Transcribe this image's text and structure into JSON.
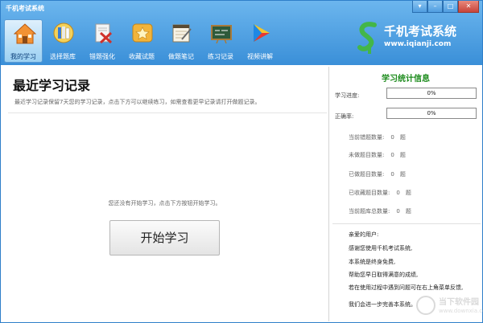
{
  "window": {
    "title": "千机考试系统",
    "minimize_glyph": "▾",
    "min_glyph": "–",
    "max_glyph": "□",
    "close_glyph": "✕"
  },
  "toolbar": {
    "items": [
      {
        "label": "我的学习",
        "icon": "home-icon",
        "active": true
      },
      {
        "label": "选择题库",
        "icon": "book-stack-icon",
        "active": false
      },
      {
        "label": "错题强化",
        "icon": "error-book-icon",
        "active": false
      },
      {
        "label": "收藏试题",
        "icon": "star-folder-icon",
        "active": false
      },
      {
        "label": "做题笔记",
        "icon": "notebook-icon",
        "active": false
      },
      {
        "label": "练习记录",
        "icon": "blackboard-icon",
        "active": false
      },
      {
        "label": "视频讲解",
        "icon": "play-icon",
        "active": false
      }
    ]
  },
  "logo": {
    "name": "千机考试系统",
    "url": "www.iqianji.com"
  },
  "main": {
    "title": "最近学习记录",
    "subtitle": "最近学习记录保留7天您的学习记录，点击下方可以继续练习，如需查看更早记录请打开做题记录。",
    "empty_hint": "您还没有开始学习，点击下方按钮开始学习。",
    "start_button": "开始学习"
  },
  "stats": {
    "title": "学习统计信息",
    "progress_label": "学习进度:",
    "progress_value": "0%",
    "progress_fraction": 0,
    "accuracy_label": "正确率:",
    "accuracy_value": "0%",
    "accuracy_fraction": 0,
    "items": [
      {
        "label": "当前错题数量:",
        "value": "0",
        "unit": "题"
      },
      {
        "label": "未做题目数量:",
        "value": "0",
        "unit": "题"
      },
      {
        "label": "已做题目数量:",
        "value": "0",
        "unit": "题"
      },
      {
        "label": "已收藏题目数量:",
        "value": "0",
        "unit": "题"
      },
      {
        "label": "当前题库总数量:",
        "value": "0",
        "unit": "题"
      }
    ]
  },
  "messages": {
    "lines": [
      "亲爱的用户:",
      "感谢您使用千机考试系统,",
      "本系统是终身免费,",
      "帮助您早日取得满意的成绩,",
      "若在使用过程中遇到问题可在右上角菜单反馈,",
      "我们会进一步完善本系统。"
    ]
  },
  "watermark": {
    "name": "当下软件园",
    "url": "www.downxia.com"
  },
  "colors": {
    "header_top": "#6cb6ee",
    "header_bottom": "#3a8fd8",
    "stats_title": "#1a8a1a",
    "progress_fill": "#6fc26f"
  }
}
